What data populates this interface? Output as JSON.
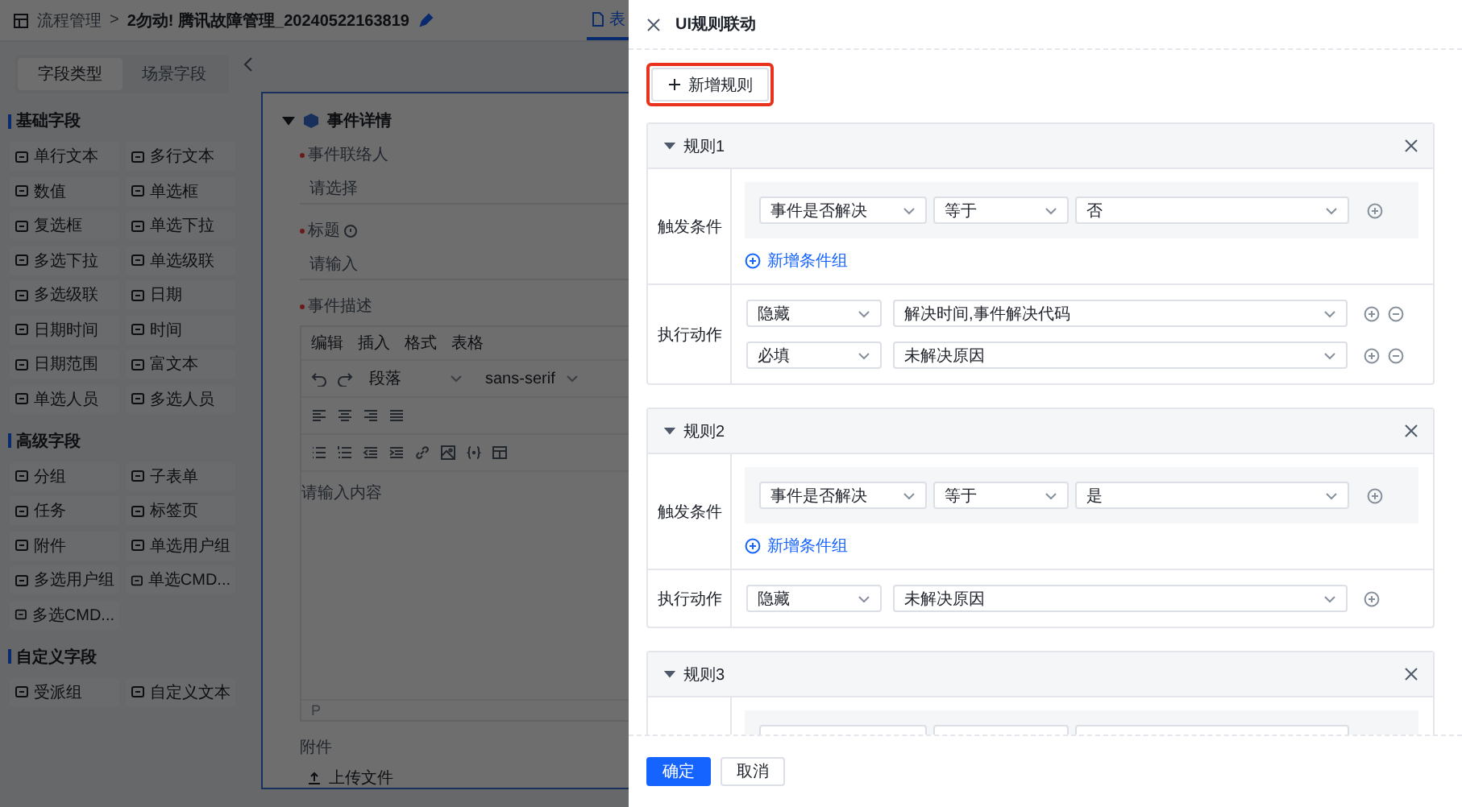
{
  "topbar": {
    "breadcrumb": "流程管理",
    "separator": ">",
    "title": "2勿动! 腾讯故障管理_20240522163819",
    "view_tab": {
      "label": "表",
      "selected": true
    }
  },
  "sidebar": {
    "tabs": [
      {
        "label": "字段类型",
        "selected": true
      },
      {
        "label": "场景字段",
        "selected": false
      }
    ],
    "sections": [
      {
        "title": "基础字段",
        "items": [
          "单行文本",
          "多行文本",
          "数值",
          "单选框",
          "复选框",
          "单选下拉",
          "多选下拉",
          "单选级联",
          "多选级联",
          "日期",
          "日期时间",
          "时间",
          "日期范围",
          "富文本",
          "单选人员",
          "多选人员"
        ]
      },
      {
        "title": "高级字段",
        "items": [
          "分组",
          "子表单",
          "任务",
          "标签页",
          "附件",
          "单选用户组",
          "多选用户组",
          "单选CMD...",
          "多选CMD..."
        ]
      },
      {
        "title": "自定义字段",
        "items": [
          "受派组",
          "自定义文本"
        ]
      }
    ]
  },
  "form": {
    "section": {
      "title": "事件详情",
      "expanded": true
    },
    "fields": [
      {
        "kind": "select",
        "label": "事件联络人",
        "required": true,
        "placeholder": "请选择"
      },
      {
        "kind": "input",
        "label": "标题",
        "required": true,
        "help": true,
        "placeholder": "请输入"
      },
      {
        "kind": "editor",
        "label": "事件描述",
        "required": true,
        "menus": [
          "编辑",
          "插入",
          "格式",
          "表格"
        ],
        "block_format": "段落",
        "font": "sans-serif",
        "placeholder": "请输入内容",
        "path": "P"
      },
      {
        "kind": "upload",
        "label": "附件",
        "required": false,
        "button": "上传文件"
      }
    ]
  },
  "drawer": {
    "title": "UI规则联动",
    "add_rule": {
      "label": "新增规则",
      "highlighted": true
    },
    "rules": [
      {
        "title": "规则1",
        "expanded": true,
        "trigger_label": "触发条件",
        "conditions": [
          {
            "field": "事件是否解决",
            "operator": "等于",
            "value": "否"
          }
        ],
        "add_group": "新增条件组",
        "action_label": "执行动作",
        "actions": [
          {
            "type": "隐藏",
            "target": "解决时间,事件解决代码",
            "removable": true
          },
          {
            "type": "必填",
            "target": "未解决原因",
            "removable": true
          }
        ]
      },
      {
        "title": "规则2",
        "expanded": true,
        "trigger_label": "触发条件",
        "conditions": [
          {
            "field": "事件是否解决",
            "operator": "等于",
            "value": "是"
          }
        ],
        "add_group": "新增条件组",
        "action_label": "执行动作",
        "actions": [
          {
            "type": "隐藏",
            "target": "未解决原因",
            "removable": false
          }
        ]
      },
      {
        "title": "规则3",
        "expanded": true
      }
    ],
    "footer": {
      "confirm": "确定",
      "cancel": "取消"
    }
  }
}
